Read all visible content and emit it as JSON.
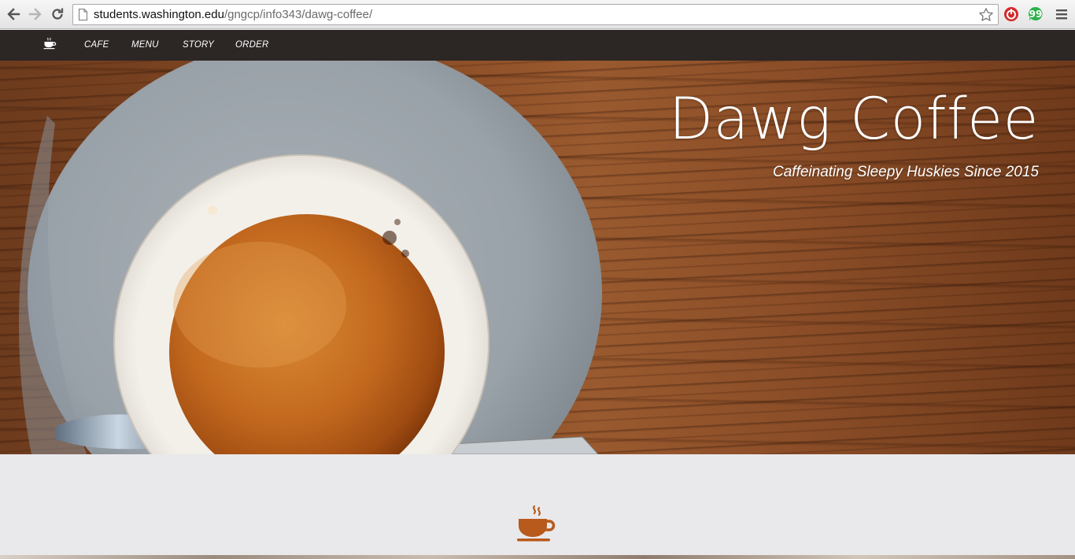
{
  "browser": {
    "url_host": "students.washington.edu",
    "url_path": "/gngcp/info343/dawg-coffee/",
    "icons": {
      "back": "back-arrow-icon",
      "forward": "forward-arrow-icon",
      "reload": "reload-icon",
      "page": "page-icon",
      "star": "bookmark-star-icon",
      "extension_1": "red-power-extension-icon",
      "extension_2": "green-quote-extension-icon",
      "menu": "hamburger-menu-icon"
    }
  },
  "nav": {
    "logo_icon": "coffee-cup-icon",
    "links": [
      {
        "label": "CAFE"
      },
      {
        "label": "MENU"
      },
      {
        "label": "STORY"
      },
      {
        "label": "ORDER"
      }
    ]
  },
  "hero": {
    "title": "Dawg Coffee",
    "subtitle": "Caffeinating Sleepy Huskies Since 2015",
    "image_icon": "coffee-cup-photo"
  },
  "section": {
    "icon": "steaming-coffee-cup-icon",
    "icon_color": "#b85a1c"
  },
  "colors": {
    "nav_bg": "#2c2624",
    "section_bg": "#e9e9ec",
    "accent": "#b85a1c"
  }
}
